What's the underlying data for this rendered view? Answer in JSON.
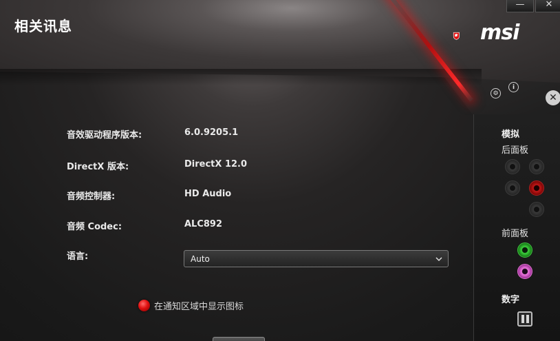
{
  "window": {
    "title": "相关讯息",
    "minimize_glyph": "—",
    "close_glyph": "✕"
  },
  "brand": {
    "name": "msi"
  },
  "icons": {
    "settings": "⚙",
    "info": "i",
    "tools": "✕"
  },
  "info": {
    "rows": [
      {
        "label": "音效驱动程序版本:",
        "value": "6.0.9205.1"
      },
      {
        "label": "DirectX 版本:",
        "value": "DirectX 12.0"
      },
      {
        "label": "音频控制器:",
        "value": "HD Audio"
      },
      {
        "label": "音频 Codec:",
        "value": "ALC892"
      }
    ],
    "language_label": "语言:",
    "language_value": "Auto"
  },
  "tray": {
    "label": "在通知区域中显示图标"
  },
  "side": {
    "analog": "模拟",
    "rear_panel": "后面板",
    "front_panel": "前面板",
    "digital": "数字"
  },
  "colors": {
    "accent_red": "#e01010",
    "jack_green": "#3ed23e",
    "jack_pink": "#f07ae0"
  }
}
